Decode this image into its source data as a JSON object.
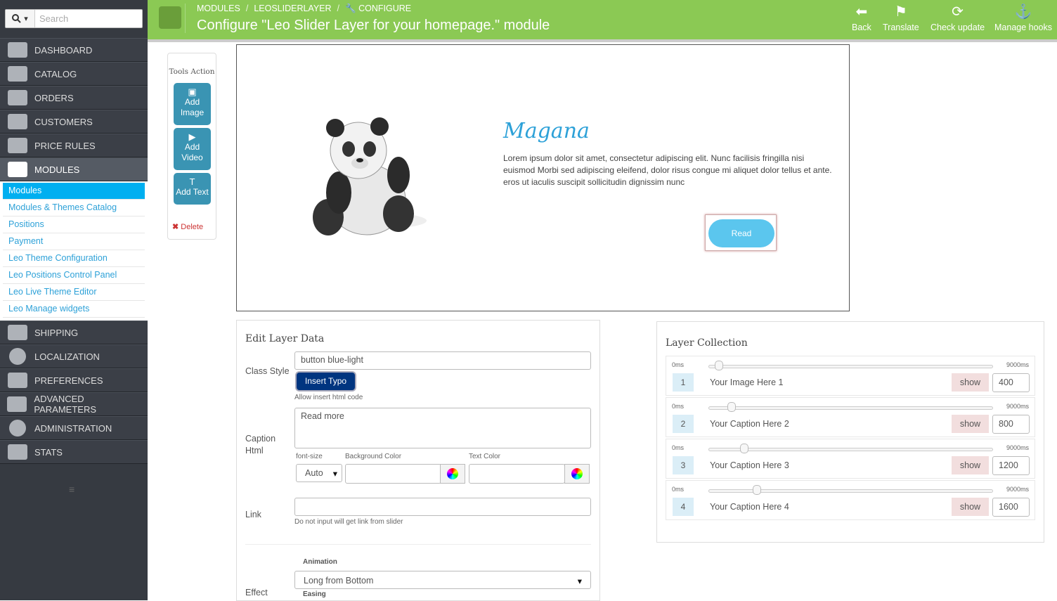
{
  "search": {
    "placeholder": "Search"
  },
  "sidebar": {
    "menu_top": [
      {
        "label": "DASHBOARD",
        "icon": "dashboard-icon"
      },
      {
        "label": "CATALOG",
        "icon": "book-icon"
      },
      {
        "label": "ORDERS",
        "icon": "credit-card-icon"
      },
      {
        "label": "CUSTOMERS",
        "icon": "users-icon"
      },
      {
        "label": "PRICE RULES",
        "icon": "tags-icon"
      },
      {
        "label": "MODULES",
        "icon": "puzzle-icon"
      }
    ],
    "submenu": [
      "Modules",
      "Modules & Themes Catalog",
      "Positions",
      "Payment",
      "Leo Theme Configuration",
      "Leo Positions Control Panel",
      "Leo Live Theme Editor",
      "Leo Manage widgets"
    ],
    "menu_bottom": [
      {
        "label": "SHIPPING",
        "icon": "truck-icon"
      },
      {
        "label": "LOCALIZATION",
        "icon": "globe-icon"
      },
      {
        "label": "PREFERENCES",
        "icon": "wrench-icon"
      },
      {
        "label": "ADVANCED PARAMETERS",
        "icon": "cogs-icon"
      },
      {
        "label": "ADMINISTRATION",
        "icon": "gear-icon"
      },
      {
        "label": "STATS",
        "icon": "bar-chart-icon"
      }
    ]
  },
  "header": {
    "breadcrumb": [
      "MODULES",
      "LEOSLIDERLAYER",
      "CONFIGURE"
    ],
    "title": "Configure \"Leo Slider Layer for your homepage.\" module",
    "buttons": {
      "back": "Back",
      "translate": "Translate",
      "check_update": "Check update",
      "manage_hooks": "Manage hooks"
    }
  },
  "preview": {
    "heading": "Magana",
    "text": "Lorem ipsum dolor sit amet, consectetur adipiscing elit. Nunc facilisis fringilla nisi euismod Morbi sed adipiscing eleifend, dolor risus congue mi aliquet dolor tellus et ante. eros ut iaculis suscipit sollicitudin dignissim nunc",
    "button": "Read"
  },
  "tools": {
    "title": "Tools Action",
    "add_image": "Add Image",
    "add_video": "Add Video",
    "add_text": "Add Text",
    "delete": "Delete"
  },
  "edit": {
    "title": "Edit Layer Data",
    "class_style_label": "Class Style",
    "class_style_value": "button blue-light",
    "insert_typo": "Insert Typo",
    "allow_html_hint": "Allow insert html code",
    "caption_label": "Caption Html",
    "caption_value": "Read more",
    "font_size_label": "font-size",
    "font_size_value": "Auto",
    "bg_color_label": "Background Color",
    "text_color_label": "Text Color",
    "link_label": "Link",
    "link_hint": "Do not input will get link from slider",
    "effect_label": "Effect",
    "animation_label": "Animation",
    "animation_value": "Long from Bottom",
    "easing_label": "Easing"
  },
  "collection": {
    "title": "Layer Collection",
    "min_label": "0ms",
    "max_label": "9000ms",
    "show_label": "show",
    "rows": [
      {
        "num": "1",
        "name": "Your Image Here 1",
        "value": "400"
      },
      {
        "num": "2",
        "name": "Your Caption Here 2",
        "value": "800"
      },
      {
        "num": "3",
        "name": "Your Caption Here 3",
        "value": "1200"
      },
      {
        "num": "4",
        "name": "Your Caption Here 4",
        "value": "1600"
      }
    ]
  }
}
